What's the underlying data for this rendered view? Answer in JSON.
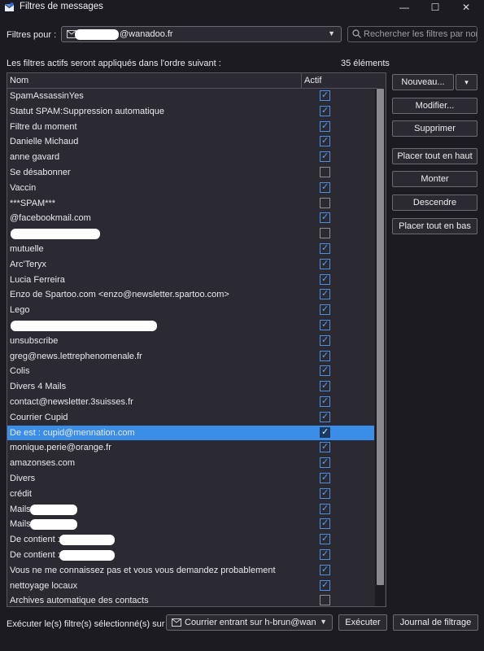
{
  "window": {
    "title": "Filtres de messages",
    "controls": {
      "minimize": "—",
      "maximize": "☐",
      "close": "✕"
    }
  },
  "header": {
    "filters_for_label": "Filtres pour :",
    "account_value": "@wanadoo.fr",
    "search_placeholder": "Rechercher les filtres par nom"
  },
  "list": {
    "order_note": "Les filtres actifs seront appliqués dans l'ordre suivant :",
    "count": "35 éléments",
    "columns": {
      "name": "Nom",
      "active": "Actif"
    },
    "rows": [
      {
        "name": "SpamAssassinYes",
        "active": true
      },
      {
        "name": "Statut SPAM:Suppression automatique",
        "active": true
      },
      {
        "name": "Filtre du moment",
        "active": true
      },
      {
        "name": "Danielle Michaud",
        "active": true
      },
      {
        "name": "anne gavard",
        "active": true
      },
      {
        "name": " Se désabonner",
        "active": false
      },
      {
        "name": "Vaccin",
        "active": true
      },
      {
        "name": "***SPAM***",
        "active": false
      },
      {
        "name": "@facebookmail.com",
        "active": true
      },
      {
        "name": "",
        "active": false,
        "redacted": true
      },
      {
        "name": "mutuelle",
        "active": true
      },
      {
        "name": "Arc'Teryx",
        "active": true
      },
      {
        "name": "Lucia Ferreira",
        "active": true
      },
      {
        "name": "Enzo de Spartoo.com <enzo@newsletter.spartoo.com>",
        "active": true
      },
      {
        "name": "Lego",
        "active": true
      },
      {
        "name": "",
        "active": true,
        "redacted": true
      },
      {
        "name": "unsubscribe",
        "active": true
      },
      {
        "name": "greg@news.lettrephenomenale.fr",
        "active": true
      },
      {
        "name": "Colis",
        "active": true
      },
      {
        "name": "Divers 4 Mails",
        "active": true
      },
      {
        "name": "contact@newsletter.3suisses.fr",
        "active": true
      },
      {
        "name": "Courrier Cupid",
        "active": true
      },
      {
        "name": "De est : cupid@mennation.com",
        "active": true,
        "selected": true
      },
      {
        "name": "monique.perie@orange.fr",
        "active": true
      },
      {
        "name": "amazonses.com",
        "active": true
      },
      {
        "name": "Divers",
        "active": true
      },
      {
        "name": "crédit",
        "active": true
      },
      {
        "name": "Mails",
        "active": true,
        "redacted": true
      },
      {
        "name": "Mails",
        "active": true,
        "redacted": true
      },
      {
        "name": "De contient :",
        "active": true,
        "redacted": true
      },
      {
        "name": "De contient :",
        "active": true,
        "redacted": true
      },
      {
        "name": "Vous ne me connaissez pas et vous vous demandez probablement",
        "active": true
      },
      {
        "name": "nettoyage locaux",
        "active": true
      },
      {
        "name": "Archives automatique des contacts",
        "active": false
      }
    ]
  },
  "buttons": {
    "new": "Nouveau...",
    "new_menu": "▾",
    "edit": "Modifier...",
    "delete": "Supprimer",
    "move_top": "Placer tout en haut",
    "move_up": "Monter",
    "move_down": "Descendre",
    "move_bottom": "Placer tout en bas"
  },
  "footer": {
    "run_label": "Exécuter le(s) filtre(s) sélectionné(s) sur :",
    "run_folder": "Courrier entrant sur h-brun@wanadoo.fr",
    "run_button": "Exécuter",
    "log_button": "Journal de filtrage"
  },
  "colors": {
    "background": "#1c1b22",
    "list_background": "#2b2a33",
    "selection": "#3b8ee8",
    "checkbox_accent": "#5aa0ff"
  }
}
